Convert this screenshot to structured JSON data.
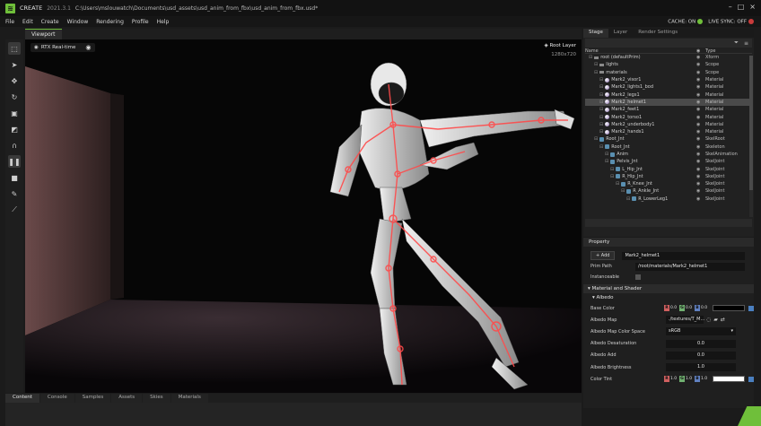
{
  "titlebar": {
    "app": "CREATE",
    "version": "2021.3.1",
    "path": "C:\\Users\\mslouwatch\\Documents\\usd_assets\\usd_anim_from_fbx\\usd_anim_from_fbx.usd*"
  },
  "menu": [
    "File",
    "Edit",
    "Create",
    "Window",
    "Rendering",
    "Profile",
    "Help"
  ],
  "status": {
    "cache_label": "CACHE:",
    "cache_state": "ON",
    "livesync_label": "LIVE SYNC:",
    "livesync_state": "OFF"
  },
  "viewport": {
    "tab": "Viewport",
    "render_mode": "RTX Real-time",
    "layer": "Root Layer",
    "resolution": "1280x720"
  },
  "bottom_tabs": [
    "Content",
    "Console",
    "Samples",
    "Assets",
    "Skies",
    "Materials"
  ],
  "right_tabs": [
    "Stage",
    "Layer",
    "Render Settings"
  ],
  "stage": {
    "col_name": "Name",
    "col_type": "Type",
    "rows": [
      {
        "name": "root (defaultPrim)",
        "type": "Xform",
        "indent": 0,
        "icon": "xf"
      },
      {
        "name": "lights",
        "type": "Scope",
        "indent": 1,
        "icon": "xf"
      },
      {
        "name": "materials",
        "type": "Scope",
        "indent": 1,
        "icon": "xf"
      },
      {
        "name": "Mark2_visor1",
        "type": "Material",
        "indent": 2,
        "icon": "mat"
      },
      {
        "name": "Mark2_lights1_bod",
        "type": "Material",
        "indent": 2,
        "icon": "mat"
      },
      {
        "name": "Mark2_legs1",
        "type": "Material",
        "indent": 2,
        "icon": "mat"
      },
      {
        "name": "Mark2_helmet1",
        "type": "Material",
        "indent": 2,
        "icon": "mat",
        "selected": true
      },
      {
        "name": "Mark2_feet1",
        "type": "Material",
        "indent": 2,
        "icon": "mat"
      },
      {
        "name": "Mark2_torso1",
        "type": "Material",
        "indent": 2,
        "icon": "mat"
      },
      {
        "name": "Mark2_underbody1",
        "type": "Material",
        "indent": 2,
        "icon": "mat"
      },
      {
        "name": "Mark2_hands1",
        "type": "Material",
        "indent": 2,
        "icon": "mat"
      },
      {
        "name": "Root_Jnt",
        "type": "SkelRoot",
        "indent": 1,
        "icon": "sk"
      },
      {
        "name": "Root_Jnt",
        "type": "Skeleton",
        "indent": 2,
        "icon": "sk"
      },
      {
        "name": "Anim",
        "type": "SkelAnimation",
        "indent": 3,
        "icon": "sk"
      },
      {
        "name": "Pelvis_Jnt",
        "type": "SkelJoint",
        "indent": 3,
        "icon": "sk"
      },
      {
        "name": "L_Hip_Jnt",
        "type": "SkelJoint",
        "indent": 4,
        "icon": "sk"
      },
      {
        "name": "R_Hip_Jnt",
        "type": "SkelJoint",
        "indent": 4,
        "icon": "sk"
      },
      {
        "name": "R_Knee_Jnt",
        "type": "SkelJoint",
        "indent": 5,
        "icon": "sk"
      },
      {
        "name": "R_Ankle_Jnt",
        "type": "SkelJoint",
        "indent": 6,
        "icon": "sk"
      },
      {
        "name": "R_LowerLeg1",
        "type": "SkelJoint",
        "indent": 7,
        "icon": "sk"
      }
    ]
  },
  "property": {
    "title": "Property",
    "add_label": "+ Add",
    "prim_name": "Mark2_helmet1",
    "path_label": "Prim Path",
    "path_value": "/root/materials/Mark2_helmet1",
    "instanceable_label": "Instanceable",
    "section": "Material and Shader",
    "subsection": "Albedo",
    "rows": [
      {
        "label": "Base Color",
        "kind": "rgb",
        "r": "0.0",
        "g": "0.0",
        "b": "0.0",
        "swatch": "#000000"
      },
      {
        "label": "Albedo Map",
        "kind": "file",
        "value": "./textures/T_M..."
      },
      {
        "label": "Albedo Map Color Space",
        "kind": "select",
        "value": "sRGB"
      },
      {
        "label": "Albedo Desaturation",
        "kind": "num",
        "value": "0.0"
      },
      {
        "label": "Albedo Add",
        "kind": "num",
        "value": "0.0"
      },
      {
        "label": "Albedo Brightness",
        "kind": "num",
        "value": "1.0"
      },
      {
        "label": "Color Tint",
        "kind": "rgb",
        "r": "1.0",
        "g": "1.0",
        "b": "1.0",
        "swatch": "#ffffff"
      }
    ]
  }
}
